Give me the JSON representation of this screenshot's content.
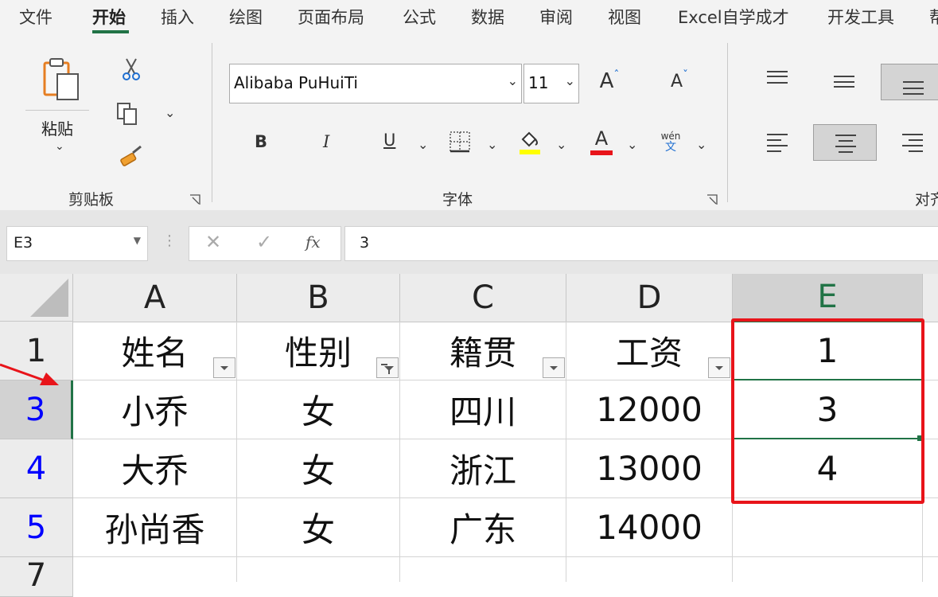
{
  "tabs": [
    "文件",
    "开始",
    "插入",
    "绘图",
    "页面布局",
    "公式",
    "数据",
    "审阅",
    "视图",
    "Excel自学成才",
    "开发工具",
    "帮"
  ],
  "active_tab": "开始",
  "ribbon": {
    "clipboard": {
      "paste_label": "粘贴",
      "group_label": "剪贴板"
    },
    "font": {
      "font_name": "Alibaba PuHuiTi",
      "font_size": "11",
      "group_label": "字体",
      "bold": "B",
      "italic": "I",
      "underline": "U",
      "font_color_letter": "A",
      "grow_letter": "A",
      "shrink_letter": "A",
      "phonetic_top": "wén",
      "phonetic_bottom": "文"
    },
    "alignment": {
      "group_label": "对齐"
    }
  },
  "formula_bar": {
    "name_box": "E3",
    "fx": "fx",
    "value": "3"
  },
  "grid": {
    "columns": [
      "A",
      "B",
      "C",
      "D",
      "E"
    ],
    "rows": [
      {
        "num": "1",
        "cells": [
          "姓名",
          "性别",
          "籍贯",
          "工资",
          "1"
        ]
      },
      {
        "num": "3",
        "cells": [
          "小乔",
          "女",
          "四川",
          "12000",
          "3"
        ]
      },
      {
        "num": "4",
        "cells": [
          "大乔",
          "女",
          "浙江",
          "13000",
          "4"
        ]
      },
      {
        "num": "5",
        "cells": [
          "孙尚香",
          "女",
          "广东",
          "14000",
          ""
        ]
      },
      {
        "num": "7",
        "cells": [
          "",
          "",
          "",
          "",
          ""
        ]
      }
    ]
  },
  "colors": {
    "accent": "#217346",
    "annotation_red": "#e8141a",
    "filtered_row_number": "#0000ff",
    "highlight_yellow": "#ffff00"
  },
  "icons": [
    "paste-icon",
    "cut-icon",
    "copy-icon",
    "format-painter-icon",
    "borders-icon",
    "fill-color-icon",
    "align-top-icon",
    "align-middle-icon",
    "align-bottom-icon",
    "align-left-icon",
    "align-center-icon",
    "align-right-icon",
    "filter-icon",
    "red-arrow-icon"
  ]
}
